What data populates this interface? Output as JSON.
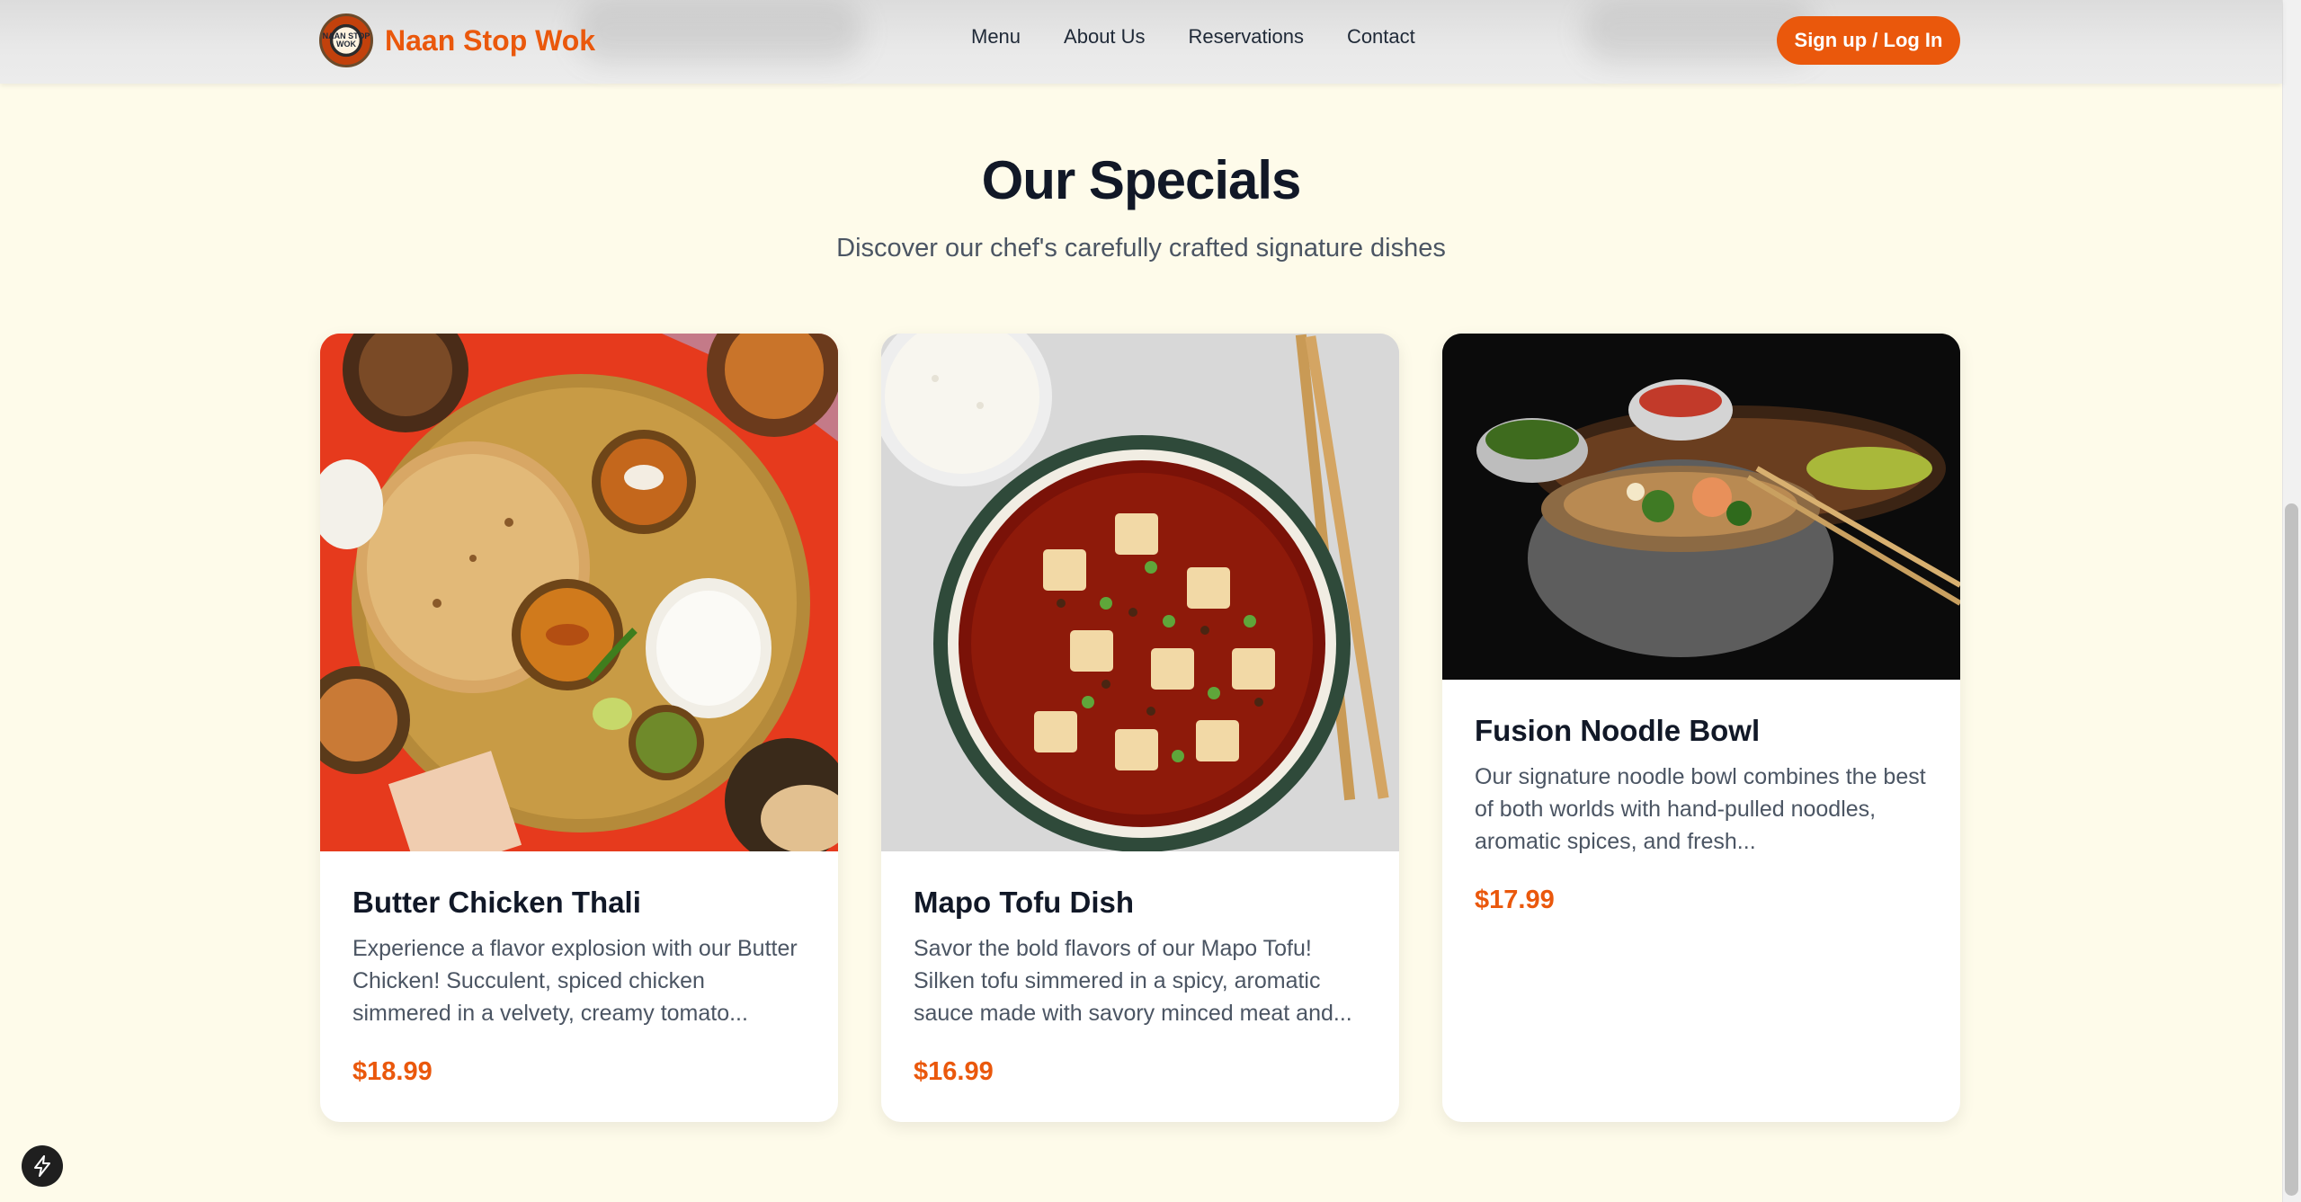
{
  "header": {
    "brand_name": "Naan Stop Wok",
    "logo_text": "NAAN STOP WOK",
    "nav": [
      "Menu",
      "About Us",
      "Reservations",
      "Contact"
    ],
    "signup_label": "Sign up / Log In"
  },
  "section": {
    "title": "Our Specials",
    "subtitle": "Discover our chef's carefully crafted signature dishes"
  },
  "specials": [
    {
      "name": "Butter Chicken Thali",
      "description": "Experience a flavor explosion with our Butter Chicken! Succulent, spiced chicken simmered in a velvety, creamy tomato...",
      "price": "$18.99",
      "image": "butter-chicken-thali-photo"
    },
    {
      "name": "Mapo Tofu Dish",
      "description": "Savor the bold flavors of our Mapo Tofu! Silken tofu simmered in a spicy, aromatic sauce made with savory minced meat and...",
      "price": "$16.99",
      "image": "mapo-tofu-photo"
    },
    {
      "name": "Fusion Noodle Bowl",
      "description": "Our signature noodle bowl combines the best of both worlds with hand-pulled noodles, aromatic spices, and fresh...",
      "price": "$17.99",
      "image": "fusion-noodle-bowl-photo"
    }
  ],
  "colors": {
    "accent": "#ea580c",
    "page_background": "#fefbea",
    "heading": "#111827",
    "body_text": "#4b5563"
  },
  "icons": {
    "fab": "lightning-bolt-icon"
  }
}
